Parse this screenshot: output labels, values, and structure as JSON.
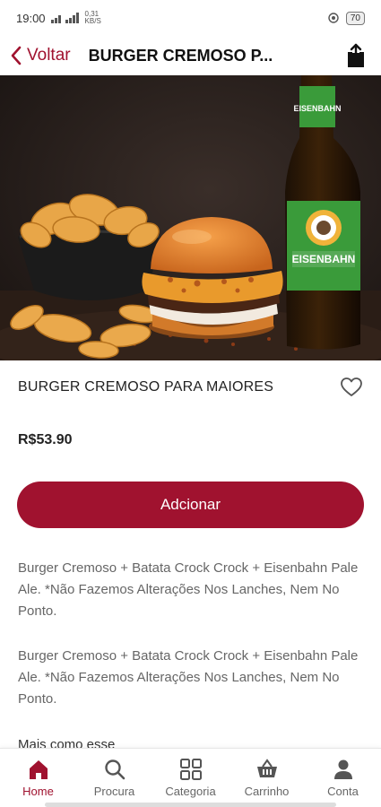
{
  "status_bar": {
    "time": "19:00",
    "signal_text": "0,31\nKB/S",
    "battery": "70"
  },
  "header": {
    "back_label": "Voltar",
    "title": "BURGER CREMOSO P..."
  },
  "product": {
    "name": "BURGER CREMOSO PARA MAIORES",
    "price": "R$53.90",
    "add_label": "Adcionar",
    "description_1": "Burger Cremoso + Batata Crock Crock + Eisenbahn Pale Ale. *Não Fazemos Alterações Nos Lanches, Nem No Ponto.",
    "description_2": "Burger Cremoso + Batata Crock Crock + Eisenbahn Pale Ale. *Não Fazemos Alterações Nos Lanches, Nem No Ponto.",
    "more_like_this": "Mais como esse",
    "image_labels": {
      "bottle": "EISENBAHN"
    }
  },
  "nav": [
    {
      "label": "Home",
      "icon": "home-icon",
      "active": true
    },
    {
      "label": "Procura",
      "icon": "search-icon",
      "active": false
    },
    {
      "label": "Categoria",
      "icon": "grid-icon",
      "active": false
    },
    {
      "label": "Carrinho",
      "icon": "basket-icon",
      "active": false
    },
    {
      "label": "Conta",
      "icon": "user-icon",
      "active": false
    }
  ],
  "colors": {
    "accent": "#a0122f",
    "text": "#222222",
    "muted": "#666666"
  }
}
